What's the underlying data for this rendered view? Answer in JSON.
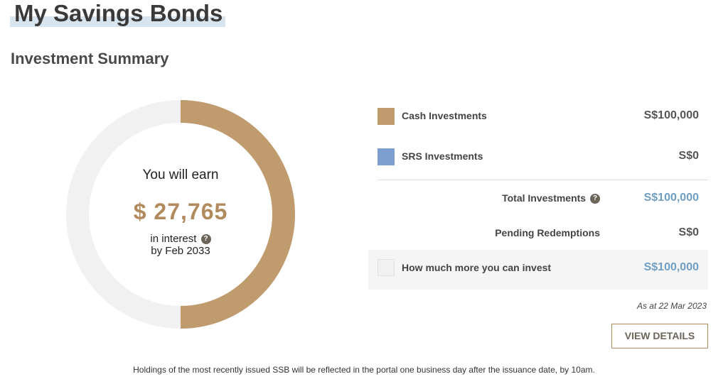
{
  "page": {
    "title": "My Savings Bonds"
  },
  "summary": {
    "section_title": "Investment Summary",
    "earn_label": "You will earn",
    "earn_amount": "$ 27,765",
    "interest_label": "in interest",
    "by_label": "by Feb 2033",
    "help_icon_glyph": "?",
    "donut_earned_fraction": 0.5,
    "colors": {
      "cash": "#c09b6e",
      "srs": "#7d9fcf",
      "track": "#f1f1f1",
      "accent": "#b18b5e",
      "link_blue": "#6f9ec4"
    },
    "rows": {
      "cash": {
        "label": "Cash Investments",
        "value": "S$100,000"
      },
      "srs": {
        "label": "SRS Investments",
        "value": "S$0"
      },
      "total": {
        "label": "Total Investments",
        "value": "S$100,000"
      },
      "pending": {
        "label": "Pending Redemptions",
        "value": "S$0"
      },
      "more": {
        "label": "How much more you can invest",
        "value": "S$100,000"
      }
    },
    "as_at": "As at 22 Mar 2023",
    "view_details": "VIEW DETAILS",
    "footnote": "Holdings of the most recently issued SSB will be reflected in the portal one business day after the issuance date, by 10am."
  }
}
